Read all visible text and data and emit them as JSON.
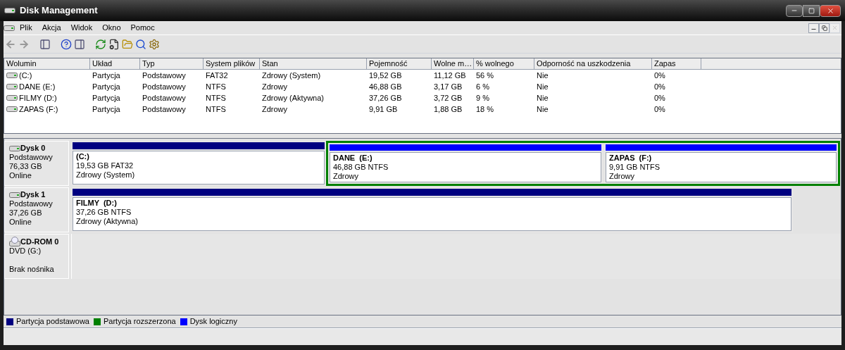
{
  "window": {
    "title": "Disk Management"
  },
  "menu": [
    "Plik",
    "Akcja",
    "Widok",
    "Okno",
    "Pomoc"
  ],
  "table": {
    "columns": [
      "Wolumin",
      "Układ",
      "Typ",
      "System plików",
      "Stan",
      "Pojemność",
      "Wolne m…",
      "% wolnego",
      "Odporność na uszkodzenia",
      "Zapas"
    ],
    "rows": [
      [
        "(C:)",
        "Partycja",
        "Podstawowy",
        "FAT32",
        "Zdrowy (System)",
        "19,52 GB",
        "11,12 GB",
        "56 %",
        "Nie",
        "0%"
      ],
      [
        "DANE (E:)",
        "Partycja",
        "Podstawowy",
        "NTFS",
        "Zdrowy",
        "46,88 GB",
        "3,17 GB",
        "6 %",
        "Nie",
        "0%"
      ],
      [
        "FILMY (D:)",
        "Partycja",
        "Podstawowy",
        "NTFS",
        "Zdrowy (Aktywna)",
        "37,26 GB",
        "3,72 GB",
        "9 %",
        "Nie",
        "0%"
      ],
      [
        "ZAPAS (F:)",
        "Partycja",
        "Podstawowy",
        "NTFS",
        "Zdrowy",
        "9,91 GB",
        "1,88 GB",
        "18 %",
        "Nie",
        "0%"
      ]
    ]
  },
  "disks": [
    {
      "kind": "disk",
      "name": "Dysk 0",
      "type": "Podstawowy",
      "size": "76,33 GB",
      "status": "Online",
      "partitions": [
        {
          "kind": "primary",
          "name": "(C:)",
          "info": "19,53 GB FAT32",
          "status": "Zdrowy (System)"
        },
        {
          "kind": "extended",
          "children": [
            {
              "kind": "logical",
              "name": "DANE  (E:)",
              "info": "46,88 GB NTFS",
              "status": "Zdrowy"
            },
            {
              "kind": "logical",
              "name": "ZAPAS  (F:)",
              "info": "9,91 GB NTFS",
              "status": "Zdrowy"
            }
          ]
        }
      ]
    },
    {
      "kind": "disk",
      "name": "Dysk 1",
      "type": "Podstawowy",
      "size": "37,26 GB",
      "status": "Online",
      "partitions": [
        {
          "kind": "primary",
          "name": "FILMY  (D:)",
          "info": "37,26 GB NTFS",
          "status": "Zdrowy (Aktywna)"
        }
      ]
    },
    {
      "kind": "cdrom",
      "name": "CD-ROM 0",
      "drive": "DVD (G:)",
      "media": "Brak nośnika"
    }
  ],
  "legend": [
    {
      "label": "Partycja podstawowa",
      "color": "#000080"
    },
    {
      "label": "Partycja rozszerzona",
      "color": "#008000"
    },
    {
      "label": "Dysk logiczny",
      "color": "#0000ff"
    }
  ]
}
